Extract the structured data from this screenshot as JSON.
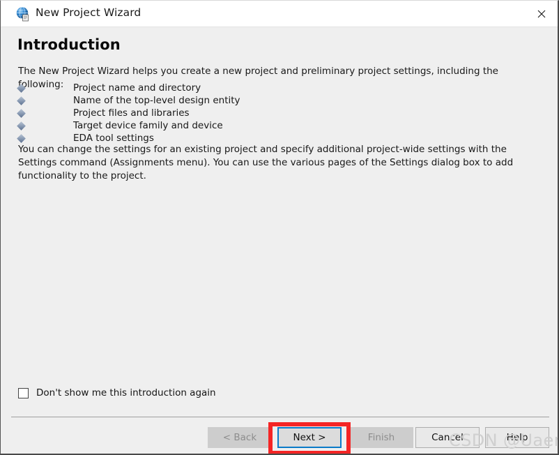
{
  "window": {
    "title": "New Project Wizard",
    "icon": "quartus-globe-icon",
    "close_label": "✕"
  },
  "content": {
    "heading": "Introduction",
    "intro_paragraph": "The New Project Wizard helps you create a new project and preliminary project settings, including the following:",
    "bullets": [
      {
        "label": "Project name and directory"
      },
      {
        "label": "Name of the top-level design entity"
      },
      {
        "label": "Project files and libraries"
      },
      {
        "label": "Target device family and device"
      },
      {
        "label": "EDA tool settings"
      }
    ],
    "note_paragraph": "You can change the settings for an existing project and specify additional project-wide settings with the Settings command (Assignments menu). You can use the various pages of the Settings dialog box to add functionality to the project."
  },
  "options": {
    "dont_show_again": {
      "label": "Don't show me this introduction again",
      "checked": false
    }
  },
  "footer": {
    "buttons": [
      {
        "label": "< Back",
        "state": "disabled"
      },
      {
        "label": "Next >",
        "state": "focused"
      },
      {
        "label": "Finish",
        "state": "disabled"
      },
      {
        "label": "Cancel",
        "state": "enabled"
      },
      {
        "label": "Help",
        "state": "enabled"
      }
    ]
  },
  "annotation": {
    "highlight_color": "#f42525",
    "focus_color": "#0a7ac8"
  },
  "watermark": {
    "text": "CSDN @Uaena.&"
  }
}
